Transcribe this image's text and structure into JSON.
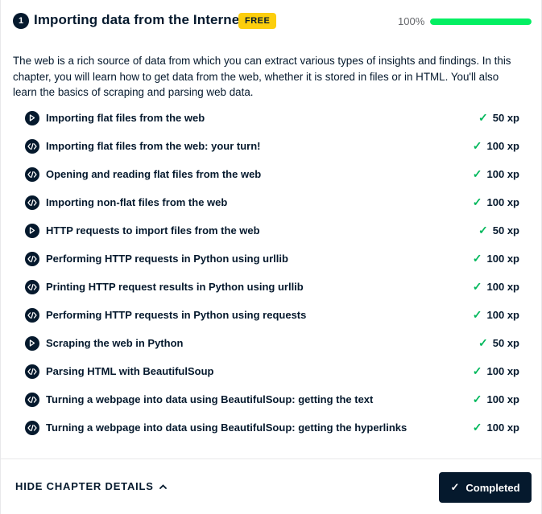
{
  "chapter": {
    "number": "1",
    "title": "Importing data from the Internet",
    "badge": "FREE",
    "progress_label": "100%",
    "progress_fraction": 1.0,
    "description": "The web is a rich source of data from which you can extract various types of insights and findings. In this chapter, you will learn how to get data from the web, whether it is stored in files or in HTML. You'll also learn the basics of scraping and parsing web data."
  },
  "exercises": [
    {
      "type": "video",
      "title": "Importing flat files from the web",
      "xp": "50 xp"
    },
    {
      "type": "code",
      "title": "Importing flat files from the web: your turn!",
      "xp": "100 xp"
    },
    {
      "type": "code",
      "title": "Opening and reading flat files from the web",
      "xp": "100 xp"
    },
    {
      "type": "code",
      "title": "Importing non-flat files from the web",
      "xp": "100 xp"
    },
    {
      "type": "video",
      "title": "HTTP requests to import files from the web",
      "xp": "50 xp"
    },
    {
      "type": "code",
      "title": "Performing HTTP requests in Python using urllib",
      "xp": "100 xp"
    },
    {
      "type": "code",
      "title": "Printing HTTP request results in Python using urllib",
      "xp": "100 xp"
    },
    {
      "type": "code",
      "title": "Performing HTTP requests in Python using requests",
      "xp": "100 xp"
    },
    {
      "type": "video",
      "title": "Scraping the web in Python",
      "xp": "50 xp"
    },
    {
      "type": "code",
      "title": "Parsing HTML with BeautifulSoup",
      "xp": "100 xp"
    },
    {
      "type": "code",
      "title": "Turning a webpage into data using BeautifulSoup: getting the text",
      "xp": "100 xp"
    },
    {
      "type": "code",
      "title": "Turning a webpage into data using BeautifulSoup: getting the hyperlinks",
      "xp": "100 xp"
    }
  ],
  "footer": {
    "hide_label": "HIDE CHAPTER DETAILS",
    "completed_label": "Completed"
  },
  "icons": {
    "video": "play-icon",
    "code": "code-icon",
    "done": "check-icon",
    "toggle": "chevron-up-icon"
  },
  "colors": {
    "navy": "#05192d",
    "progress": "#03ef62",
    "check": "#02b85c",
    "badge": "#fcce0d"
  }
}
